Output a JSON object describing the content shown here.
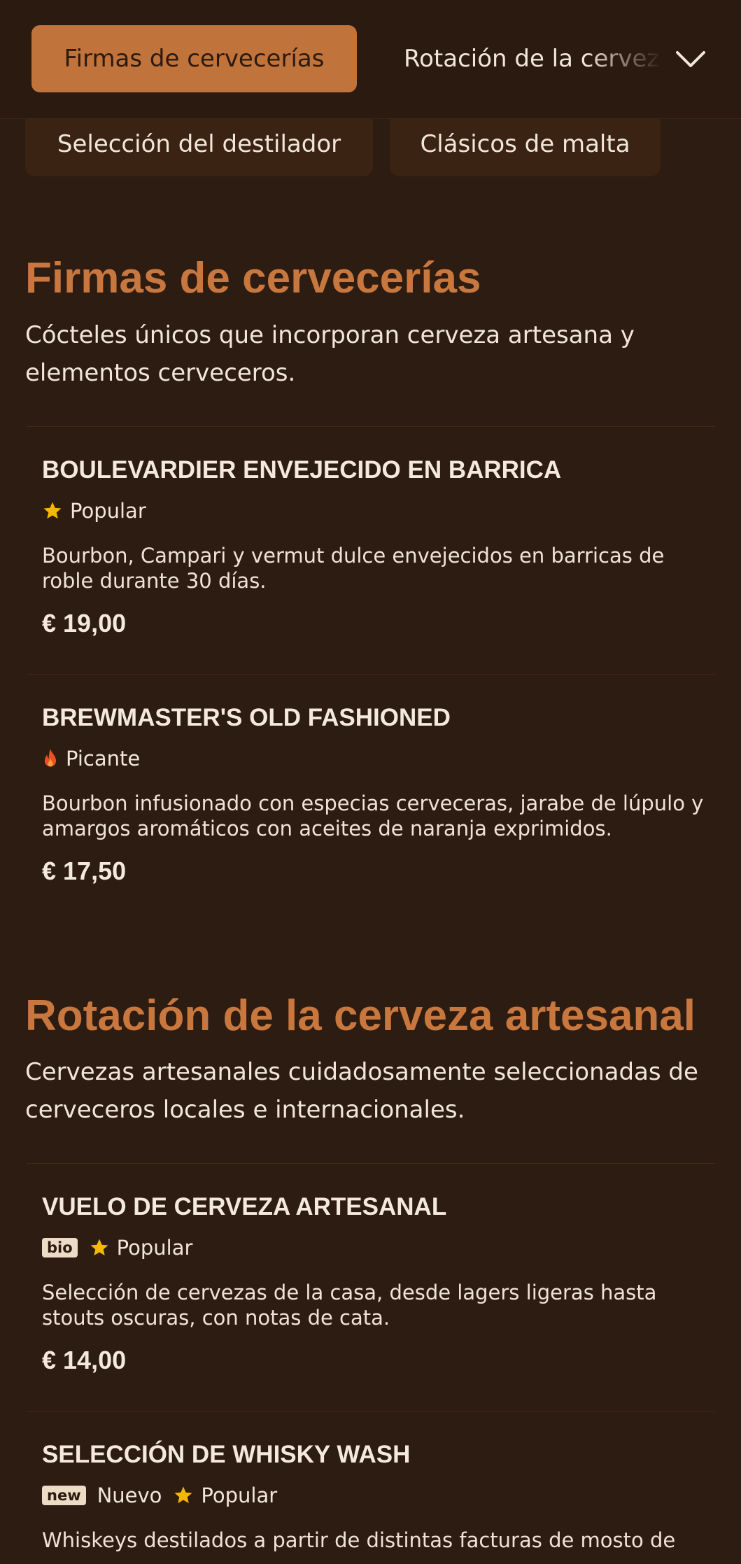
{
  "nav": {
    "active_tab": "Firmas de cervecerías",
    "next_tab": "Rotación de la cerveza artesanal",
    "chips": [
      "Selección del destilador",
      "Clásicos de malta"
    ]
  },
  "sections": [
    {
      "title": "Firmas de cervecerías",
      "description": "Cócteles únicos que incorporan cerveza artesana y elementos cerveceros.",
      "items": [
        {
          "name": "BOULEVARDIER ENVEJECIDO EN BARRICA",
          "tags": [
            "Popular"
          ],
          "description": "Bourbon, Campari y vermut dulce envejecidos en barricas de roble durante 30 días.",
          "price": "€ 19,00"
        },
        {
          "name": "BREWMASTER'S OLD FASHIONED",
          "tags": [
            "Picante"
          ],
          "description": "Bourbon infusionado con especias cerveceras, jarabe de lúpulo y amargos aromáticos con aceites de naranja exprimidos.",
          "price": "€ 17,50"
        }
      ]
    },
    {
      "title": "Rotación de la cerveza artesanal",
      "description": "Cervezas artesanales cuidadosamente seleccionadas de cerveceros locales e internacionales.",
      "items": [
        {
          "name": "VUELO DE CERVEZA ARTESANAL",
          "badge": "bio",
          "tags": [
            "Popular"
          ],
          "description": "Selección de cervezas de la casa, desde lagers ligeras hasta stouts oscuras, con notas de cata.",
          "price": "€ 14,00"
        },
        {
          "name": "SELECCIÓN DE WHISKY WASH",
          "badge": "new",
          "tags": [
            "Nuevo",
            "Popular"
          ],
          "description": "Whiskeys destilados a partir de distintas facturas de mosto de"
        }
      ]
    }
  ],
  "icons": {
    "popular": "star-icon",
    "picante": "flame-icon",
    "dropdown": "chevron-down-icon"
  },
  "colors": {
    "background": "#2d1c12",
    "accent": "#c0733a",
    "star": "#f5b800",
    "flame": "#e8531f"
  }
}
